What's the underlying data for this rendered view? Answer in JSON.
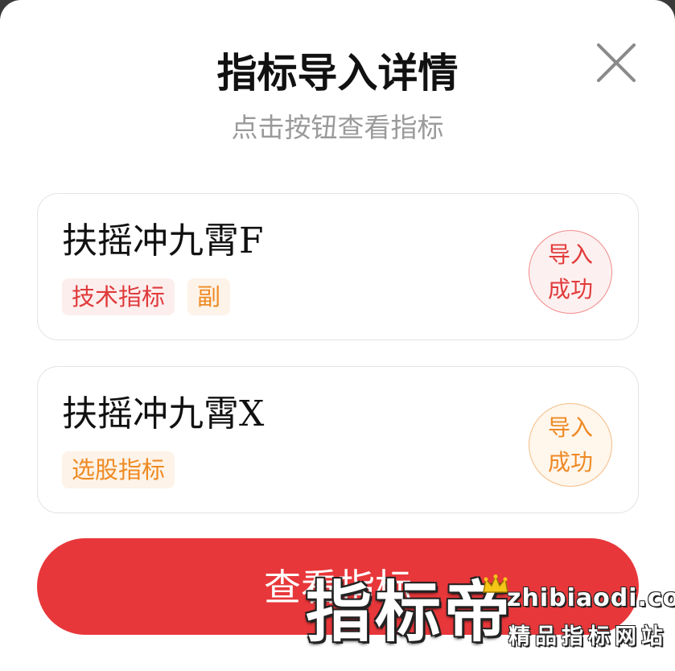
{
  "dialog": {
    "title": "指标导入详情",
    "subtitle": "点击按钮查看指标",
    "close_icon": "close-icon"
  },
  "indicators": [
    {
      "name": "扶摇冲九霄F",
      "tags": [
        {
          "label": "技术指标",
          "color": "#e03a3a"
        },
        {
          "label": "副",
          "color": "#ef8a22"
        }
      ],
      "status": {
        "line1": "导入",
        "line2": "成功",
        "color": "#e23b3b"
      }
    },
    {
      "name": "扶摇冲九霄X",
      "tags": [
        {
          "label": "选股指标",
          "color": "#ef8a22"
        }
      ],
      "status": {
        "line1": "导入",
        "line2": "成功",
        "color": "#ee8a25"
      }
    }
  ],
  "primary_button": {
    "label": "查看指标",
    "color": "#e8373a"
  },
  "watermark": {
    "brand": "指标帝",
    "domain": "zhibiaodi.com",
    "slogan": "精品指标网站",
    "icon": "crown-icon"
  }
}
